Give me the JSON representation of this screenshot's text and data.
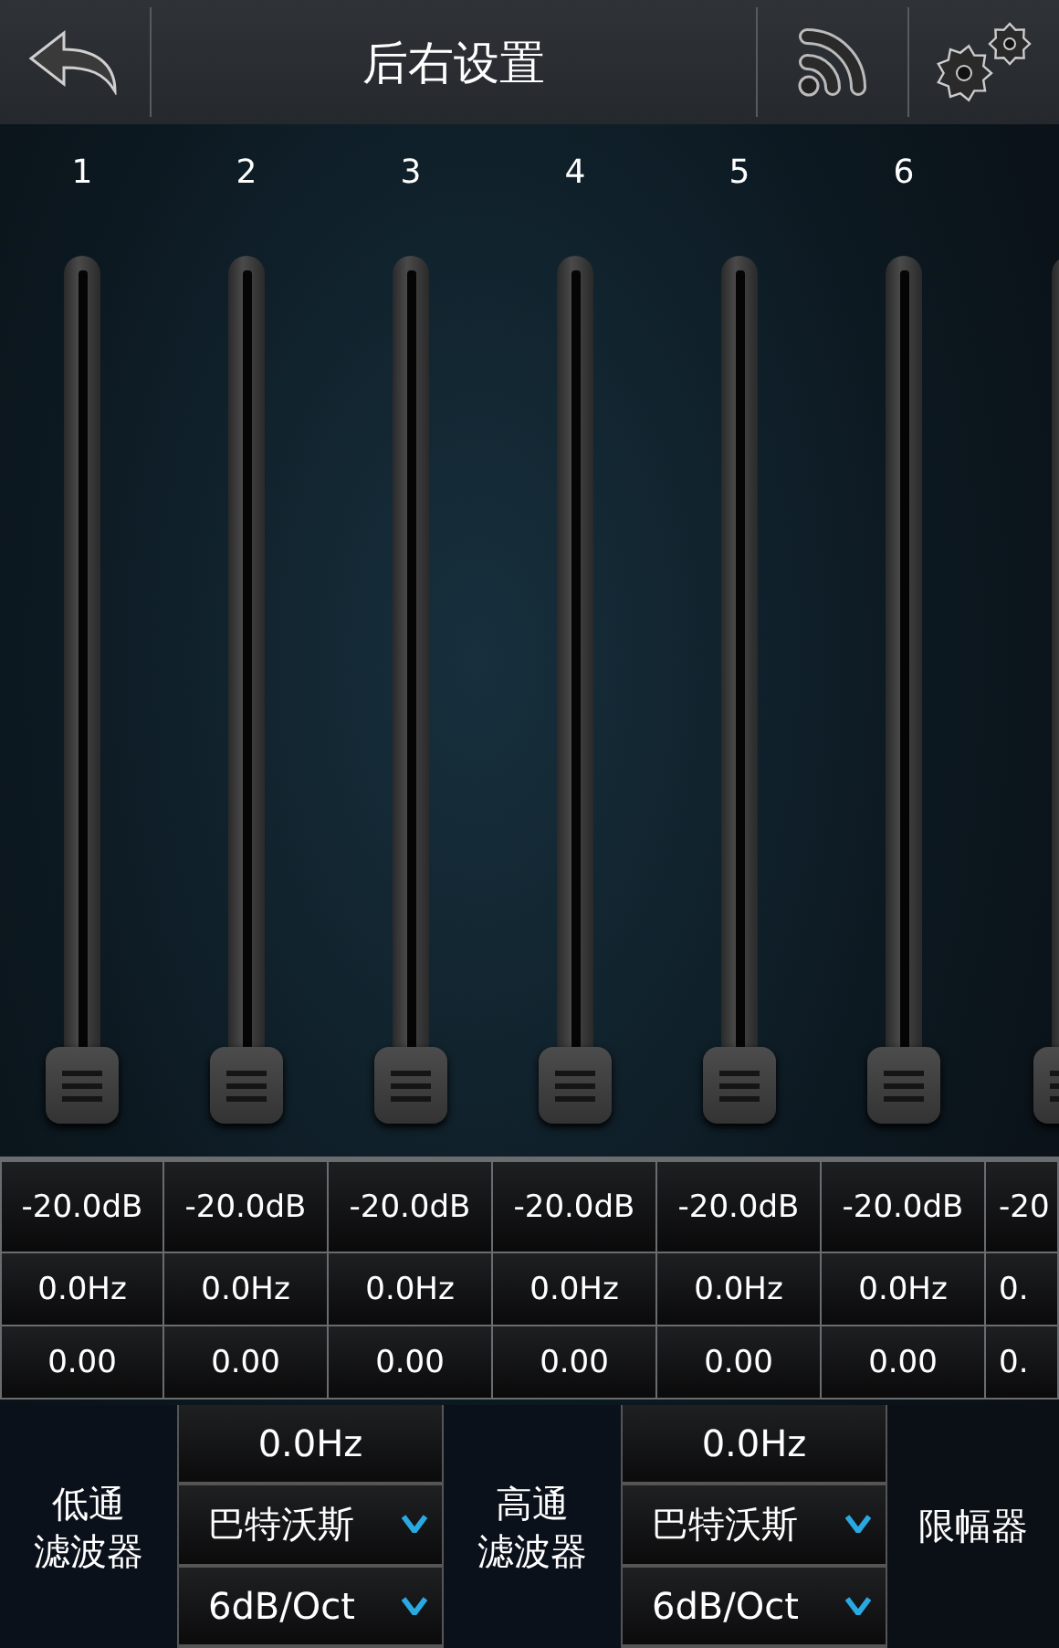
{
  "header": {
    "title": "后右设置"
  },
  "channels": [
    {
      "label": "1",
      "gain": "-20.0dB",
      "frequency": "0.0Hz",
      "q": "0.00"
    },
    {
      "label": "2",
      "gain": "-20.0dB",
      "frequency": "0.0Hz",
      "q": "0.00"
    },
    {
      "label": "3",
      "gain": "-20.0dB",
      "frequency": "0.0Hz",
      "q": "0.00"
    },
    {
      "label": "4",
      "gain": "-20.0dB",
      "frequency": "0.0Hz",
      "q": "0.00"
    },
    {
      "label": "5",
      "gain": "-20.0dB",
      "frequency": "0.0Hz",
      "q": "0.00"
    },
    {
      "label": "6",
      "gain": "-20.0dB",
      "frequency": "0.0Hz",
      "q": "0.00"
    },
    {
      "gain": "-20",
      "frequency": "0.",
      "q": "0."
    }
  ],
  "filters": [
    {
      "title_lines": [
        "低通",
        "滤波器"
      ],
      "frequency": "0.0Hz",
      "type": "巴特沃斯",
      "slope": "6dB/Oct"
    },
    {
      "title_lines": [
        "高通",
        "滤波器"
      ],
      "frequency": "0.0Hz",
      "type": "巴特沃斯",
      "slope": "6dB/Oct"
    }
  ],
  "limiter": {
    "label": "限幅器"
  }
}
